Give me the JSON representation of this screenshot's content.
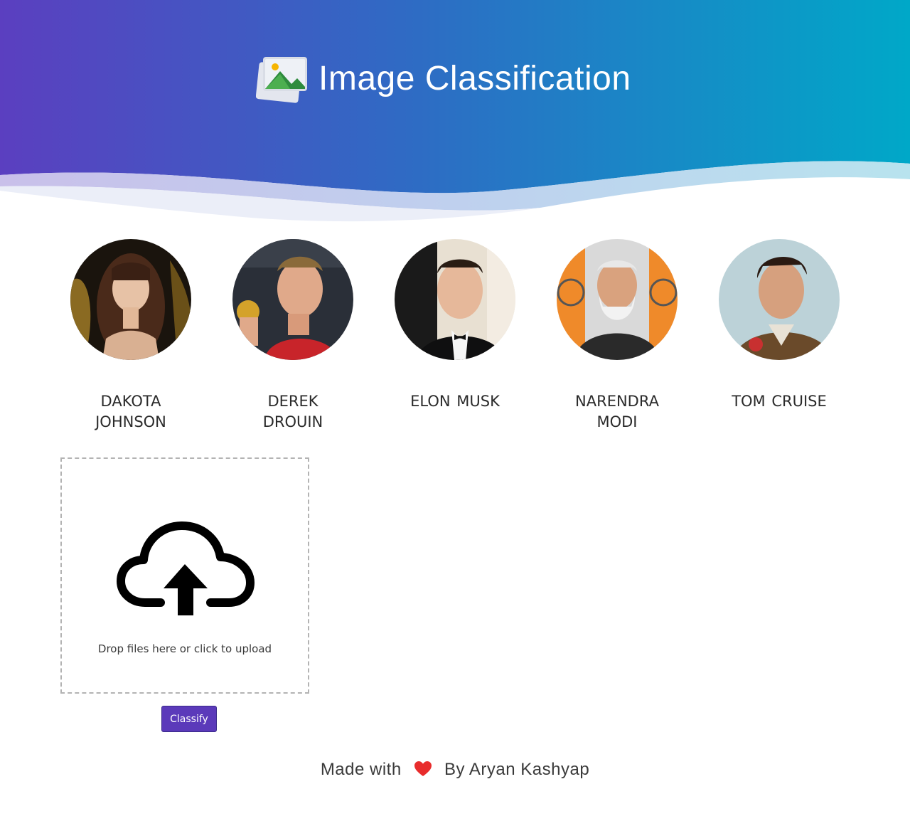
{
  "header": {
    "title": "Image Classification",
    "logo_icon": "image-gallery-icon",
    "gradient": [
      "#5b3fc0",
      "#2f6bc4",
      "#00a8c8"
    ]
  },
  "celebrities": [
    {
      "name": "DAKOTA JOHNSON",
      "photo": "dakota-johnson-photo"
    },
    {
      "name": "DEREK DROUIN",
      "photo": "derek-drouin-photo"
    },
    {
      "name": "ELON MUSK",
      "photo": "elon-musk-photo"
    },
    {
      "name": "NARENDRA MODI",
      "photo": "narendra-modi-photo"
    },
    {
      "name": "TOM CRUISE",
      "photo": "tom-cruise-photo"
    }
  ],
  "upload": {
    "icon": "cloud-upload-icon",
    "hint": "Drop files here or click to upload"
  },
  "classify_button": {
    "label": "Classify",
    "color": "#5b3aba"
  },
  "footer": {
    "made_with": "Made with",
    "heart_icon": "heart-icon",
    "author": "By Aryan Kashyap",
    "heart_color": "#e82c2c"
  }
}
